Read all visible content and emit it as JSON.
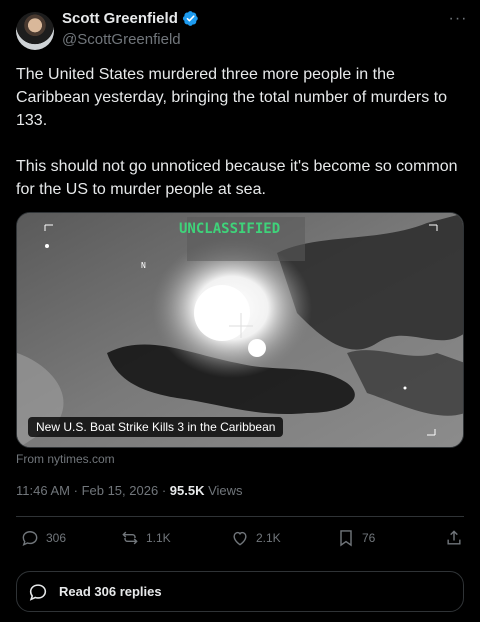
{
  "author": {
    "name": "Scott Greenfield",
    "handle": "@ScottGreenfield",
    "verified": true
  },
  "tweet": {
    "text": "The United States murdered three more people in the Caribbean yesterday, bringing the total number of murders to 133.\n\nThis should not go unnoticed because it's become so common for the US to murder people at sea."
  },
  "media": {
    "overlay_label": "UNCLASSIFIED",
    "compass_label": "N",
    "caption": "New U.S. Boat Strike Kills 3 in the Caribbean",
    "source": "From nytimes.com"
  },
  "meta": {
    "time": "11:46 AM",
    "date": "Feb 15, 2026",
    "separator": "·",
    "views_count": "95.5K",
    "views_label": "Views"
  },
  "actions": {
    "replies": "306",
    "reposts": "1.1K",
    "likes": "2.1K",
    "bookmarks": "76"
  },
  "read_replies_label": "Read 306 replies",
  "colors": {
    "background": "#000000",
    "text": "#e7e9ea",
    "muted": "#71767b",
    "verified_blue": "#1d9bf0",
    "border": "#2f3336",
    "overlay_green": "#3fd37a"
  },
  "icons": [
    "verified-badge-icon",
    "more-icon",
    "reply-icon",
    "repost-icon",
    "like-icon",
    "bookmark-icon",
    "share-icon",
    "replies-bubble-icon"
  ]
}
